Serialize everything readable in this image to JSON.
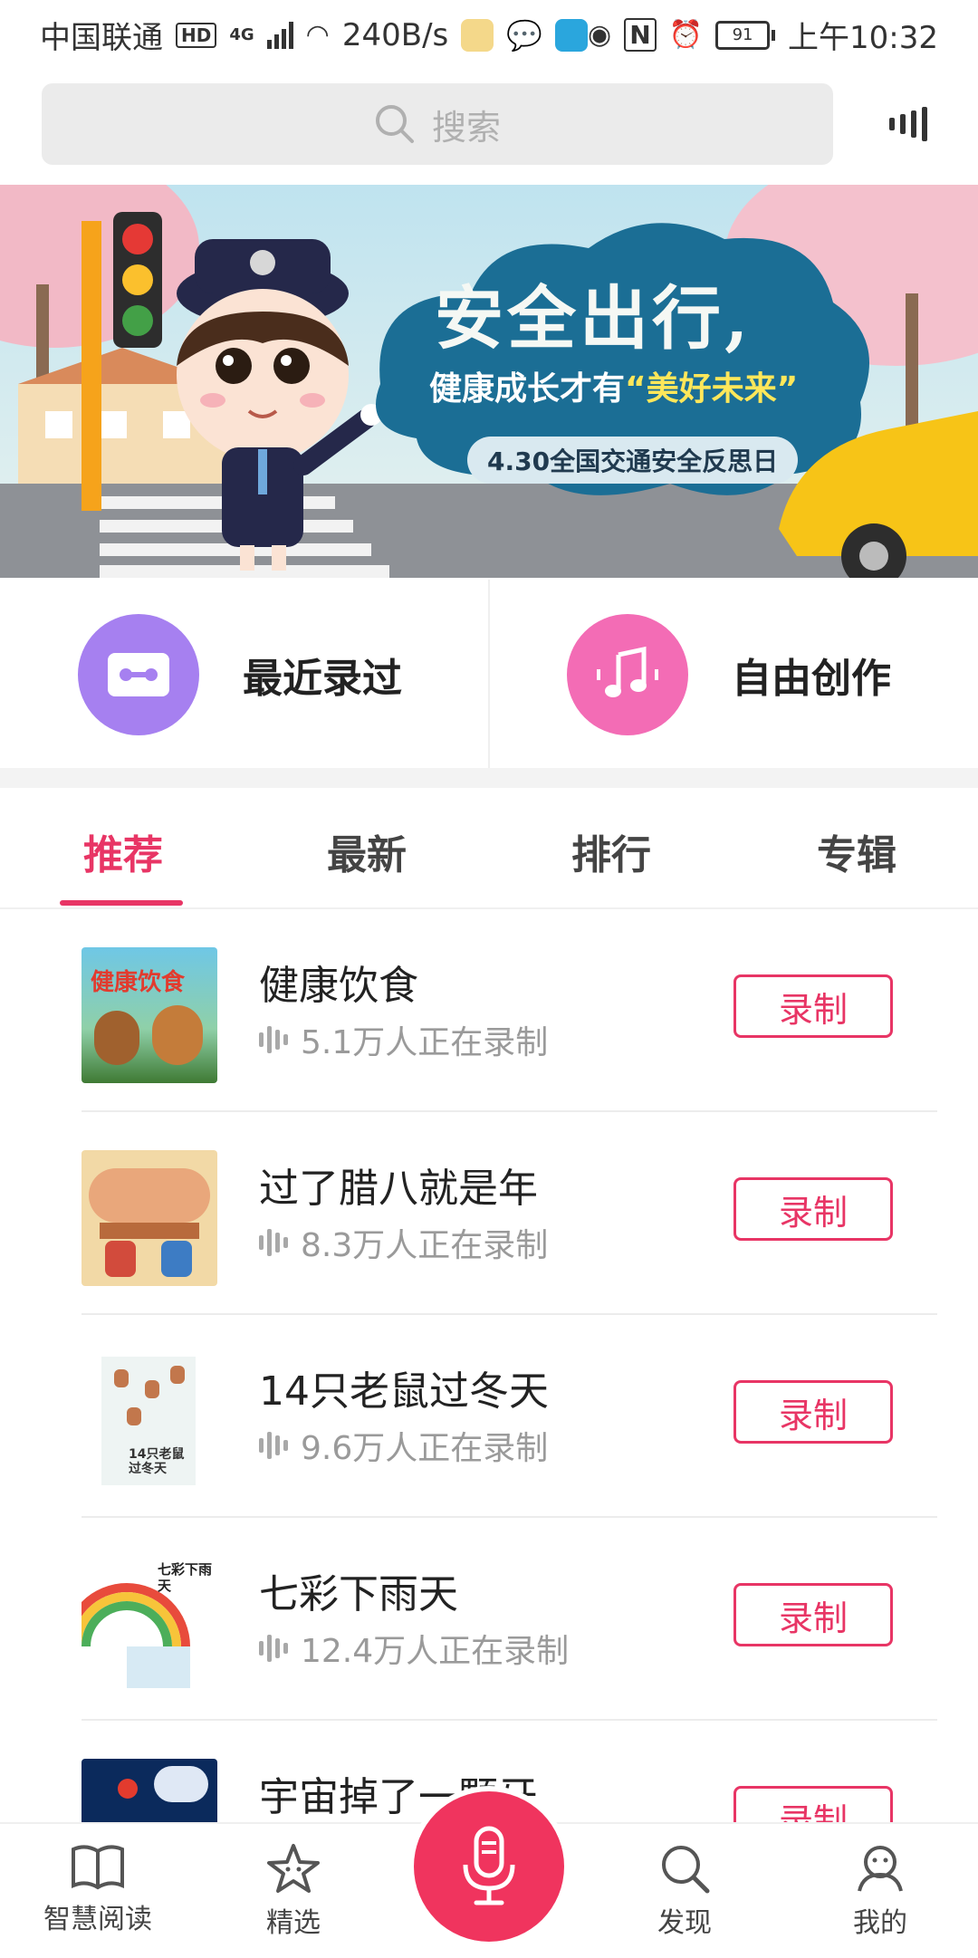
{
  "status_bar": {
    "carrier": "中国联通",
    "hd": "HD",
    "network": "4G",
    "speed": "240B/s",
    "battery": "91",
    "time": "上午10:32"
  },
  "search": {
    "placeholder": "搜索"
  },
  "banner": {
    "headline": "安全出行,",
    "subline_prefix": "健康成长才有",
    "subline_quote": "“美好未来”",
    "tag": "4.30全国交通安全反思日"
  },
  "quick_actions": [
    {
      "label": "最近录过",
      "icon": "cassette-icon",
      "color": "#a680f0"
    },
    {
      "label": "自由创作",
      "icon": "music-note-icon",
      "color": "#f36cb5"
    }
  ],
  "tabs": [
    {
      "label": "推荐",
      "active": true
    },
    {
      "label": "最新",
      "active": false
    },
    {
      "label": "排行",
      "active": false
    },
    {
      "label": "专辑",
      "active": false
    }
  ],
  "books": [
    {
      "title": "健康饮食",
      "count": "5.1万人正在录制",
      "button": "录制",
      "cover_text": "健康饮食"
    },
    {
      "title": "过了腊八就是年",
      "count": "8.3万人正在录制",
      "button": "录制",
      "cover_text": ""
    },
    {
      "title": "14只老鼠过冬天",
      "count": "9.6万人正在录制",
      "button": "录制",
      "cover_text": "14只老鼠过冬天"
    },
    {
      "title": "七彩下雨天",
      "count": "12.4万人正在录制",
      "button": "录制",
      "cover_text": "七彩下雨天"
    },
    {
      "title": "宇宙掉了一颗牙",
      "count": "",
      "button": "录制",
      "cover_text": ""
    }
  ],
  "bottom_nav": [
    {
      "label": "智慧阅读",
      "icon": "book-icon"
    },
    {
      "label": "精选",
      "icon": "star-icon"
    },
    {
      "label": "",
      "icon": "microphone-icon"
    },
    {
      "label": "发现",
      "icon": "search-icon"
    },
    {
      "label": "我的",
      "icon": "user-icon"
    }
  ],
  "colors": {
    "accent": "#e83565",
    "mic": "#f0345e"
  }
}
